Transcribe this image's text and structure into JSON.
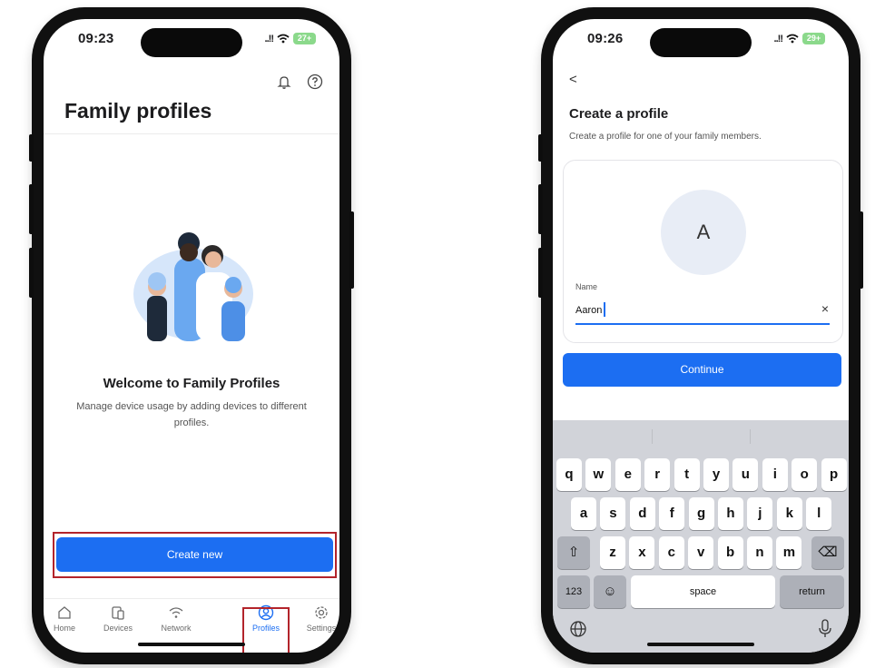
{
  "colors": {
    "accent": "#1c6ef2",
    "highlight": "#b3242b"
  },
  "screen1": {
    "status": {
      "time": "09:23",
      "signal": "..!!",
      "battery": "27+"
    },
    "top_icons": [
      "bell-icon",
      "help-icon"
    ],
    "title": "Family profiles",
    "welcome_title": "Welcome to Family Profiles",
    "welcome_desc": "Manage device usage by adding devices to different profiles.",
    "create_button": "Create new",
    "tabs": [
      {
        "label": "Home",
        "icon": "home-icon"
      },
      {
        "label": "Devices",
        "icon": "devices-icon"
      },
      {
        "label": "Network",
        "icon": "wifi-icon"
      },
      {
        "label": "Profiles",
        "icon": "profile-icon",
        "active": true
      },
      {
        "label": "Settings",
        "icon": "gear-icon"
      }
    ]
  },
  "screen2": {
    "status": {
      "time": "09:26",
      "signal": "..!!",
      "battery": "29+"
    },
    "back": "<",
    "title": "Create a profile",
    "subtitle": "Create a profile for one of your family members.",
    "avatar_letter": "A",
    "name_label": "Name",
    "name_value": "Aaron",
    "clear": "×",
    "continue_button": "Continue",
    "keyboard": {
      "row1": [
        "q",
        "w",
        "e",
        "r",
        "t",
        "y",
        "u",
        "i",
        "o",
        "p"
      ],
      "row2": [
        "a",
        "s",
        "d",
        "f",
        "g",
        "h",
        "j",
        "k",
        "l"
      ],
      "row3": [
        "z",
        "x",
        "c",
        "v",
        "b",
        "n",
        "m"
      ],
      "shift": "⇧",
      "backspace": "⌫",
      "numbers": "123",
      "emoji": "☺",
      "space": "space",
      "return": "return"
    }
  }
}
